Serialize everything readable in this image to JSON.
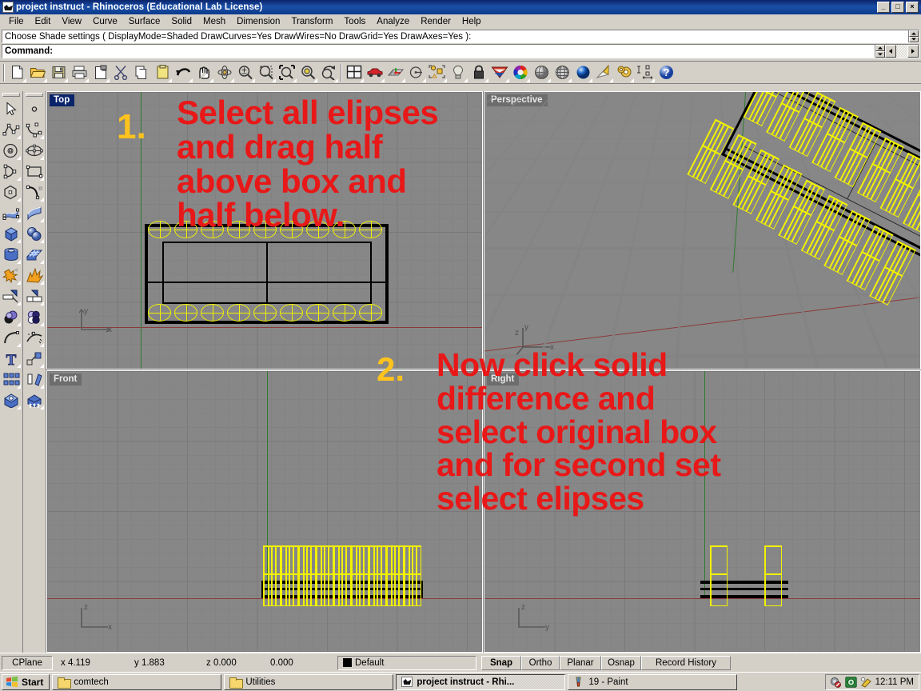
{
  "window": {
    "title": "project instruct - Rhinoceros (Educational Lab License)",
    "app_icon": "rhino-icon",
    "minimize_label": "_",
    "maximize_label": "□",
    "close_label": "×"
  },
  "menubar": {
    "items": [
      {
        "label": "File"
      },
      {
        "label": "Edit"
      },
      {
        "label": "View"
      },
      {
        "label": "Curve"
      },
      {
        "label": "Surface"
      },
      {
        "label": "Solid"
      },
      {
        "label": "Mesh"
      },
      {
        "label": "Dimension"
      },
      {
        "label": "Transform"
      },
      {
        "label": "Tools"
      },
      {
        "label": "Analyze"
      },
      {
        "label": "Render"
      },
      {
        "label": "Help"
      }
    ]
  },
  "command_area": {
    "history_line": "Choose Shade settings ( DisplayMode=Shaded  DrawCurves=Yes  DrawWires=No  DrawGrid=Yes  DrawAxes=Yes ):",
    "prompt_label": "Command:",
    "prompt_value": ""
  },
  "main_toolbar": {
    "tools": [
      {
        "name": "new-file-icon",
        "title": "New"
      },
      {
        "name": "open-folder-icon",
        "title": "Open"
      },
      {
        "name": "save-icon",
        "title": "Save"
      },
      {
        "name": "print-icon",
        "title": "Print"
      },
      {
        "name": "copy-to-clipboard-icon",
        "title": "Copy to clipboard"
      },
      {
        "name": "cut-scissors-icon",
        "title": "Cut"
      },
      {
        "name": "copy-pages-icon",
        "title": "Copy"
      },
      {
        "name": "paste-clipboard-icon",
        "title": "Paste"
      },
      {
        "name": "undo-arrow-icon",
        "title": "Undo"
      },
      {
        "name": "pan-hand-icon",
        "title": "Pan"
      },
      {
        "name": "rotate-view-icon",
        "title": "Rotate view"
      },
      {
        "name": "zoom-in-out-icon",
        "title": "Zoom"
      },
      {
        "name": "zoom-window-icon",
        "title": "Zoom window"
      },
      {
        "name": "zoom-extents-icon",
        "title": "Zoom extents"
      },
      {
        "name": "zoom-selected-icon",
        "title": "Zoom selected"
      },
      {
        "name": "zoom-previous-icon",
        "title": "Zoom previous"
      },
      {
        "name": "four-viewport-icon",
        "title": "Viewport layout"
      },
      {
        "name": "car-icon",
        "title": "Named views"
      },
      {
        "name": "grid-plane-icon",
        "title": "Set CPlane"
      },
      {
        "name": "circle-point-icon",
        "title": "Object snap"
      },
      {
        "name": "object-properties-icon",
        "title": "Properties"
      },
      {
        "name": "lightbulb-icon",
        "title": "Lights"
      },
      {
        "name": "lock-icon",
        "title": "Lock"
      },
      {
        "name": "material-icon",
        "title": "Material"
      },
      {
        "name": "color-wheel-icon",
        "title": "Color"
      },
      {
        "name": "shaded-sphere-icon",
        "title": "Shaded view"
      },
      {
        "name": "wireframe-sphere-icon",
        "title": "Wireframe view"
      },
      {
        "name": "render-sphere-icon",
        "title": "Rendered view"
      },
      {
        "name": "flat-shade-icon",
        "title": "Flat shade"
      },
      {
        "name": "render-settings-gear-icon",
        "title": "Render settings"
      },
      {
        "name": "dimension-icon",
        "title": "Dimension"
      },
      {
        "name": "help-icon",
        "title": "Help"
      }
    ]
  },
  "sidebar": {
    "column1": [
      {
        "name": "select-arrow-icon",
        "label": "Select objects"
      },
      {
        "name": "polyline-icon",
        "label": "Polyline"
      },
      {
        "name": "circle-icon",
        "label": "Circle"
      },
      {
        "name": "arc-icon",
        "label": "Arc"
      },
      {
        "name": "polygon-icon",
        "label": "Polygon"
      },
      {
        "name": "surface-from-points-icon",
        "label": "Surface from points"
      },
      {
        "name": "box-solid-icon",
        "label": "Box"
      },
      {
        "name": "cylinder-icon",
        "label": "Cylinder"
      },
      {
        "name": "explode-star-icon",
        "label": "Explode"
      },
      {
        "name": "trim-icon",
        "label": "Trim"
      },
      {
        "name": "boolean-union-icon",
        "label": "Boolean union"
      },
      {
        "name": "fillet-curve-icon",
        "label": "Fillet curve"
      },
      {
        "name": "text-tool-icon",
        "label": "Text"
      },
      {
        "name": "array-icon",
        "label": "Array"
      },
      {
        "name": "cap-planar-holes-icon",
        "label": "Cap planar holes"
      }
    ],
    "column2": [
      {
        "name": "point-object-icon",
        "label": "Point"
      },
      {
        "name": "control-point-curve-icon",
        "label": "Control point curve"
      },
      {
        "name": "ellipse-icon",
        "label": "Ellipse"
      },
      {
        "name": "rectangle-icon",
        "label": "Rectangle"
      },
      {
        "name": "curve-from-points-icon",
        "label": "Curve interpolate"
      },
      {
        "name": "extrude-surface-icon",
        "label": "Extrude surface"
      },
      {
        "name": "sphere-union-icon",
        "label": "Sphere"
      },
      {
        "name": "surface-patch-icon",
        "label": "Surface patch"
      },
      {
        "name": "explode-burst-icon",
        "label": "Explode burst"
      },
      {
        "name": "split-icon",
        "label": "Split"
      },
      {
        "name": "boolean-difference-icon",
        "label": "Boolean difference"
      },
      {
        "name": "blend-curve-icon",
        "label": "Blend curve"
      },
      {
        "name": "scale-icon",
        "label": "Scale"
      },
      {
        "name": "rotate-copy-icon",
        "label": "Rotate"
      },
      {
        "name": "extrude-ruler-icon",
        "label": "Extrude"
      }
    ]
  },
  "viewports": {
    "top": {
      "label": "Top",
      "active": true,
      "axis_labels": {
        "h": "x",
        "v": "y"
      }
    },
    "perspective": {
      "label": "Perspective",
      "active": false,
      "axis_labels": {
        "h": "x",
        "v": "y",
        "d": "z"
      }
    },
    "front": {
      "label": "Front",
      "active": false,
      "axis_labels": {
        "h": "x",
        "v": "z"
      }
    },
    "right": {
      "label": "Right",
      "active": false,
      "axis_labels": {
        "h": "y",
        "v": "z"
      }
    }
  },
  "annotations": [
    {
      "number": "1.",
      "text": "Select all elipses\nand drag half\nabove box and\nhalf below.",
      "color": "#e81818",
      "number_color": "#ffc31e"
    },
    {
      "number": "2.",
      "text": "Now click solid\ndifference and\nselect original box\nand for second set\nselect elipses",
      "color": "#e81818",
      "number_color": "#ffc31e"
    }
  ],
  "statusbar": {
    "cplane_label": "CPlane",
    "x_value": "x 4.119",
    "y_value": "y 1.883",
    "z_value": "z 0.000",
    "extra_value": "0.000",
    "layer_name": "Default",
    "layer_color": "#000000",
    "toggles": [
      {
        "label": "Snap",
        "on": true
      },
      {
        "label": "Ortho",
        "on": false
      },
      {
        "label": "Planar",
        "on": false
      },
      {
        "label": "Osnap",
        "on": false
      },
      {
        "label": "Record History",
        "on": false
      }
    ]
  },
  "taskbar": {
    "start_label": "Start",
    "tasks": [
      {
        "label": "comtech",
        "icon": "folder-icon",
        "active": false
      },
      {
        "label": "Utilities",
        "icon": "folder-icon",
        "active": false
      },
      {
        "label": "project instruct - Rhi...",
        "icon": "rhino-icon",
        "active": true
      },
      {
        "label": "19 - Paint",
        "icon": "paint-icon",
        "active": false
      }
    ],
    "tray_icons": [
      "network-icon",
      "volume-icon",
      "paint-tray-icon"
    ],
    "clock": "12:11 PM"
  },
  "theme": {
    "title_blue": "#0a246a",
    "face": "#d4d0c8",
    "viewport_bg": "#878787",
    "geometry_yellow": "#f2f200",
    "geometry_black": "#000000",
    "axis_red": "#8b3a3a",
    "axis_green": "#2f7a2f"
  }
}
